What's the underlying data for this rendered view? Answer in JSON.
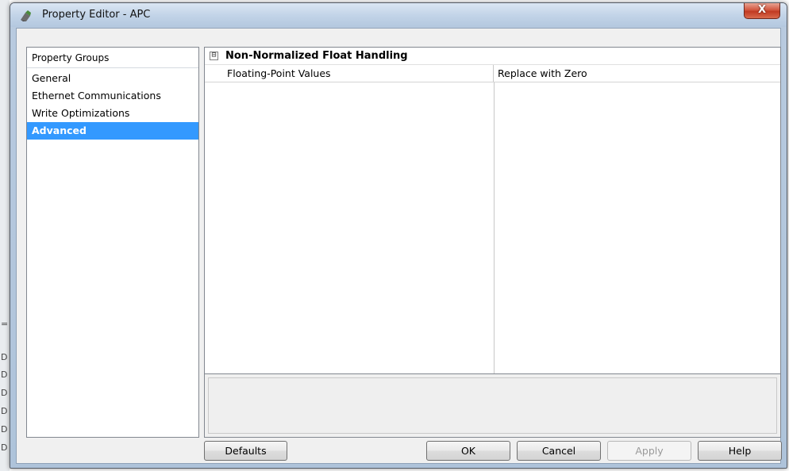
{
  "window": {
    "title": "Property Editor - APC",
    "close_label": "X"
  },
  "background_marks": [
    "=",
    "D",
    "D",
    "D",
    "D",
    "D",
    "D"
  ],
  "property_groups": {
    "header": "Property Groups",
    "items": [
      {
        "label": "General",
        "selected": false
      },
      {
        "label": "Ethernet Communications",
        "selected": false
      },
      {
        "label": "Write Optimizations",
        "selected": false
      },
      {
        "label": "Advanced",
        "selected": true
      }
    ]
  },
  "property_grid": {
    "category": {
      "label": "Non-Normalized Float Handling",
      "expand_symbol": "⊟",
      "expanded": true
    },
    "properties": [
      {
        "name": "Floating-Point Values",
        "value": "Replace with Zero"
      }
    ]
  },
  "description": "",
  "buttons": {
    "defaults": "Defaults",
    "ok": "OK",
    "cancel": "Cancel",
    "apply": "Apply",
    "help": "Help"
  },
  "colors": {
    "selection": "#3399ff",
    "close_button": "#c13a22"
  }
}
